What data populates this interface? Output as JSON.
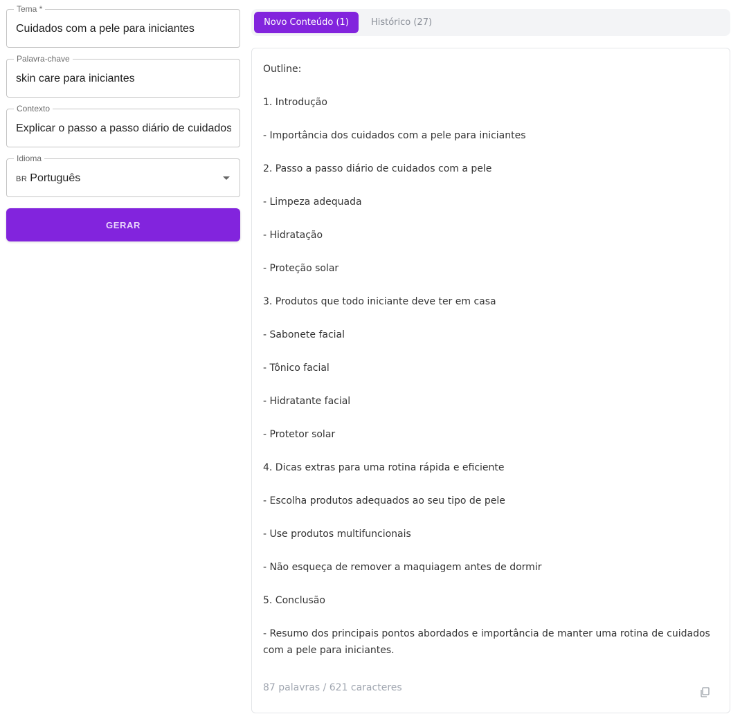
{
  "form": {
    "tema": {
      "label": "Tema *",
      "value": "Cuidados com a pele para iniciantes"
    },
    "keyword": {
      "label": "Palavra-chave",
      "value": "skin care para iniciantes"
    },
    "context": {
      "label": "Contexto",
      "value": "Explicar o passo a passo diário de cuidados com a pele"
    },
    "language": {
      "label": "Idioma",
      "code": "BR",
      "value": "Português"
    },
    "generate_label": "GERAR"
  },
  "tabs": [
    {
      "label": "Novo Conteúdo (1)",
      "active": true
    },
    {
      "label": "Histórico (27)",
      "active": false
    }
  ],
  "content": {
    "lines": [
      "Outline:",
      "1. Introdução",
      "- Importância dos cuidados com a pele para iniciantes",
      "2. Passo a passo diário de cuidados com a pele",
      "- Limpeza adequada",
      "- Hidratação",
      "- Proteção solar",
      "3. Produtos que todo iniciante deve ter em casa",
      "- Sabonete facial",
      "- Tônico facial",
      "- Hidratante facial",
      "- Protetor solar",
      "4. Dicas extras para uma rotina rápida e eficiente",
      "- Escolha produtos adequados ao seu tipo de pele",
      "- Use produtos multifuncionais",
      "- Não esqueça de remover a maquiagem antes de dormir",
      "5. Conclusão",
      "- Resumo dos principais pontos abordados e importância de manter uma rotina de cuidados com a pele para iniciantes."
    ],
    "stats": "87 palavras / 621 caracteres"
  },
  "colors": {
    "primary": "#8224dd",
    "tab_bar_bg": "#f3f4f6",
    "muted_text": "#a0a6b0"
  },
  "icons": {
    "dropdown": "chevron-down-icon",
    "copy": "copy-icon"
  }
}
